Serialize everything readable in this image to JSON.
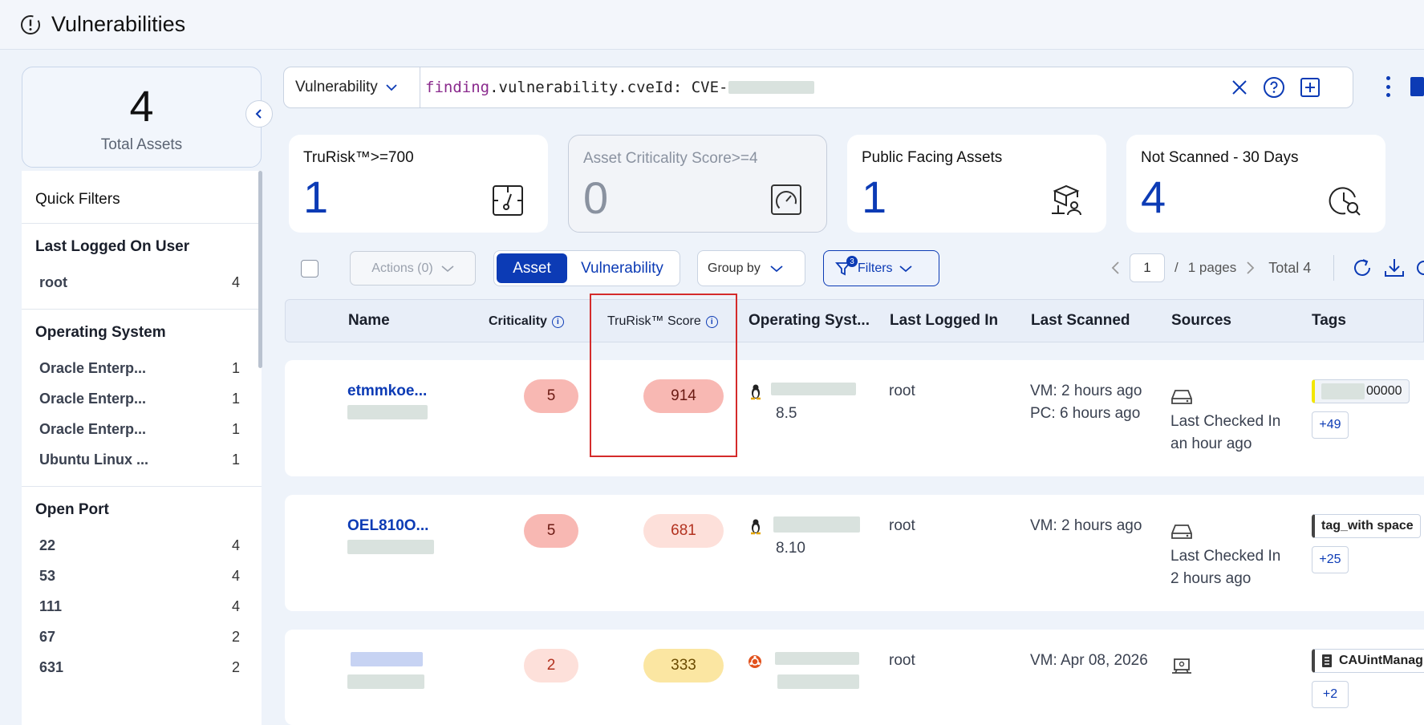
{
  "header": {
    "title": "Vulnerabilities"
  },
  "summary": {
    "total_value": "4",
    "total_label": "Total Assets"
  },
  "quick_filters": {
    "title": "Quick Filters",
    "groups": [
      {
        "title": "Last Logged On User",
        "items": [
          {
            "label": "root",
            "count": "4"
          }
        ]
      },
      {
        "title": "Operating System",
        "items": [
          {
            "label": "Oracle Enterp...",
            "count": "1"
          },
          {
            "label": "Oracle Enterp...",
            "count": "1"
          },
          {
            "label": "Oracle Enterp...",
            "count": "1"
          },
          {
            "label": "Ubuntu Linux ...",
            "count": "1"
          }
        ]
      },
      {
        "title": "Open Port",
        "items": [
          {
            "label": "22",
            "count": "4"
          },
          {
            "label": "53",
            "count": "4"
          },
          {
            "label": "111",
            "count": "4"
          },
          {
            "label": "67",
            "count": "2"
          },
          {
            "label": "631",
            "count": "2"
          }
        ]
      }
    ]
  },
  "search": {
    "type_label": "Vulnerability",
    "query_prefix": "finding",
    "query_rest": ".vulnerability.cveId: CVE-"
  },
  "stats": [
    {
      "label": "TruRisk™>=700",
      "value": "1",
      "icon": "gauge-needle-icon"
    },
    {
      "label": "Asset Criticality Score>=4",
      "value": "0",
      "icon": "speedometer-icon"
    },
    {
      "label": "Public Facing Assets",
      "value": "1",
      "icon": "public-asset-icon"
    },
    {
      "label": "Not Scanned - 30 Days",
      "value": "4",
      "icon": "clock-search-icon"
    }
  ],
  "toolbar": {
    "actions_label": "Actions (0)",
    "seg_asset": "Asset",
    "seg_vulnerability": "Vulnerability",
    "groupby_label": "Group by",
    "filters_label": "Filters",
    "filters_count": "3",
    "page_current": "1",
    "page_sep": "/",
    "pages_label": "1 pages",
    "total_label": "Total 4"
  },
  "table": {
    "columns": {
      "name": "Name",
      "criticality": "Criticality",
      "trurisk": "TruRisk™ Score",
      "os": "Operating Syst...",
      "last_logged": "Last Logged In",
      "last_scanned": "Last Scanned",
      "sources": "Sources",
      "tags": "Tags"
    },
    "rows": [
      {
        "name": "etmmkoe...",
        "criticality": "5",
        "trurisk": "914",
        "os_version": "8.5",
        "user": "root",
        "scan1": "VM: 2 hours ago",
        "scan2": "PC: 6 hours ago",
        "source_line1": "Last Checked In",
        "source_line2": "an hour ago",
        "tag": "00000",
        "tag_more": "+49"
      },
      {
        "name": "OEL810O...",
        "criticality": "5",
        "trurisk": "681",
        "os_version": "8.10",
        "user": "root",
        "scan1": "VM: 2 hours ago",
        "scan2": "",
        "source_line1": "Last Checked In",
        "source_line2": "2 hours ago",
        "tag": "tag_with space",
        "tag_more": "+25"
      },
      {
        "name": "",
        "criticality": "2",
        "trurisk": "333",
        "os_version": "",
        "user": "root",
        "scan1": "VM: Apr 08, 2026",
        "scan2": "",
        "source_line1": "",
        "source_line2": "",
        "tag": "CAUintManag",
        "tag_more": "+2"
      }
    ]
  },
  "colors": {
    "accent": "#0c3bb5",
    "highlight_box": "#d42b2b",
    "pill_red_strong": "#f8b8b3",
    "pill_red_light": "#fde0da",
    "pill_yellow": "#fbe6a2"
  }
}
